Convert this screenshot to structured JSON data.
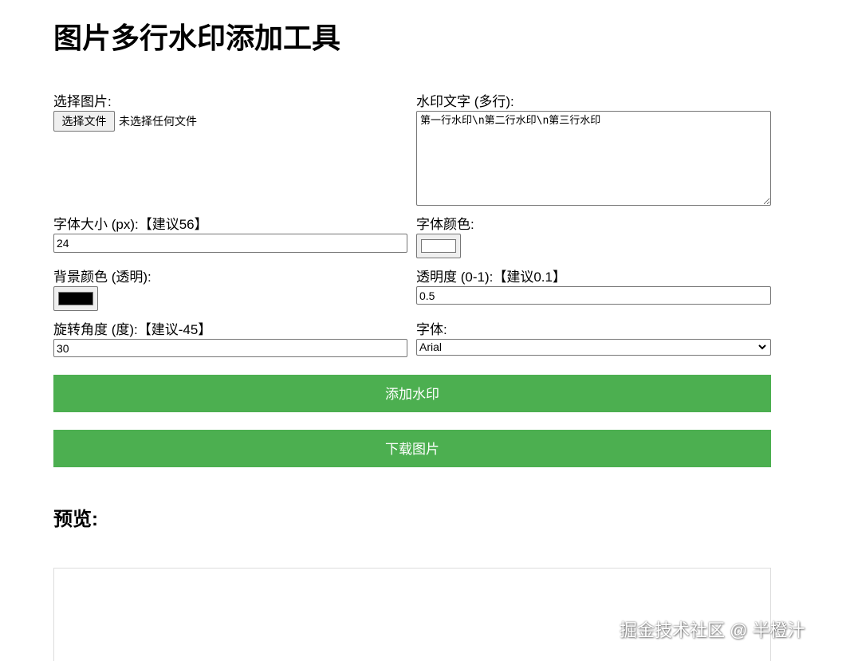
{
  "title": "图片多行水印添加工具",
  "image": {
    "label": "选择图片:",
    "button_label": "选择文件",
    "status": "未选择任何文件"
  },
  "watermark_text": {
    "label": "水印文字 (多行):",
    "value": "第一行水印\\n第二行水印\\n第三行水印"
  },
  "font_size": {
    "label": "字体大小 (px):【建议56】",
    "value": "24"
  },
  "font_color": {
    "label": "字体颜色:",
    "value": "#ffffff"
  },
  "bg_color": {
    "label": "背景颜色 (透明):",
    "value": "#000000"
  },
  "opacity": {
    "label": "透明度 (0-1):【建议0.1】",
    "value": "0.5"
  },
  "rotation": {
    "label": "旋转角度 (度):【建议-45】",
    "value": "30"
  },
  "font_family": {
    "label": "字体:",
    "selected": "Arial"
  },
  "buttons": {
    "add_watermark": "添加水印",
    "download": "下载图片"
  },
  "preview": {
    "heading": "预览:"
  },
  "credit": "掘金技术社区 @ 半橙汁",
  "colors": {
    "button_green": "#4caf50"
  }
}
